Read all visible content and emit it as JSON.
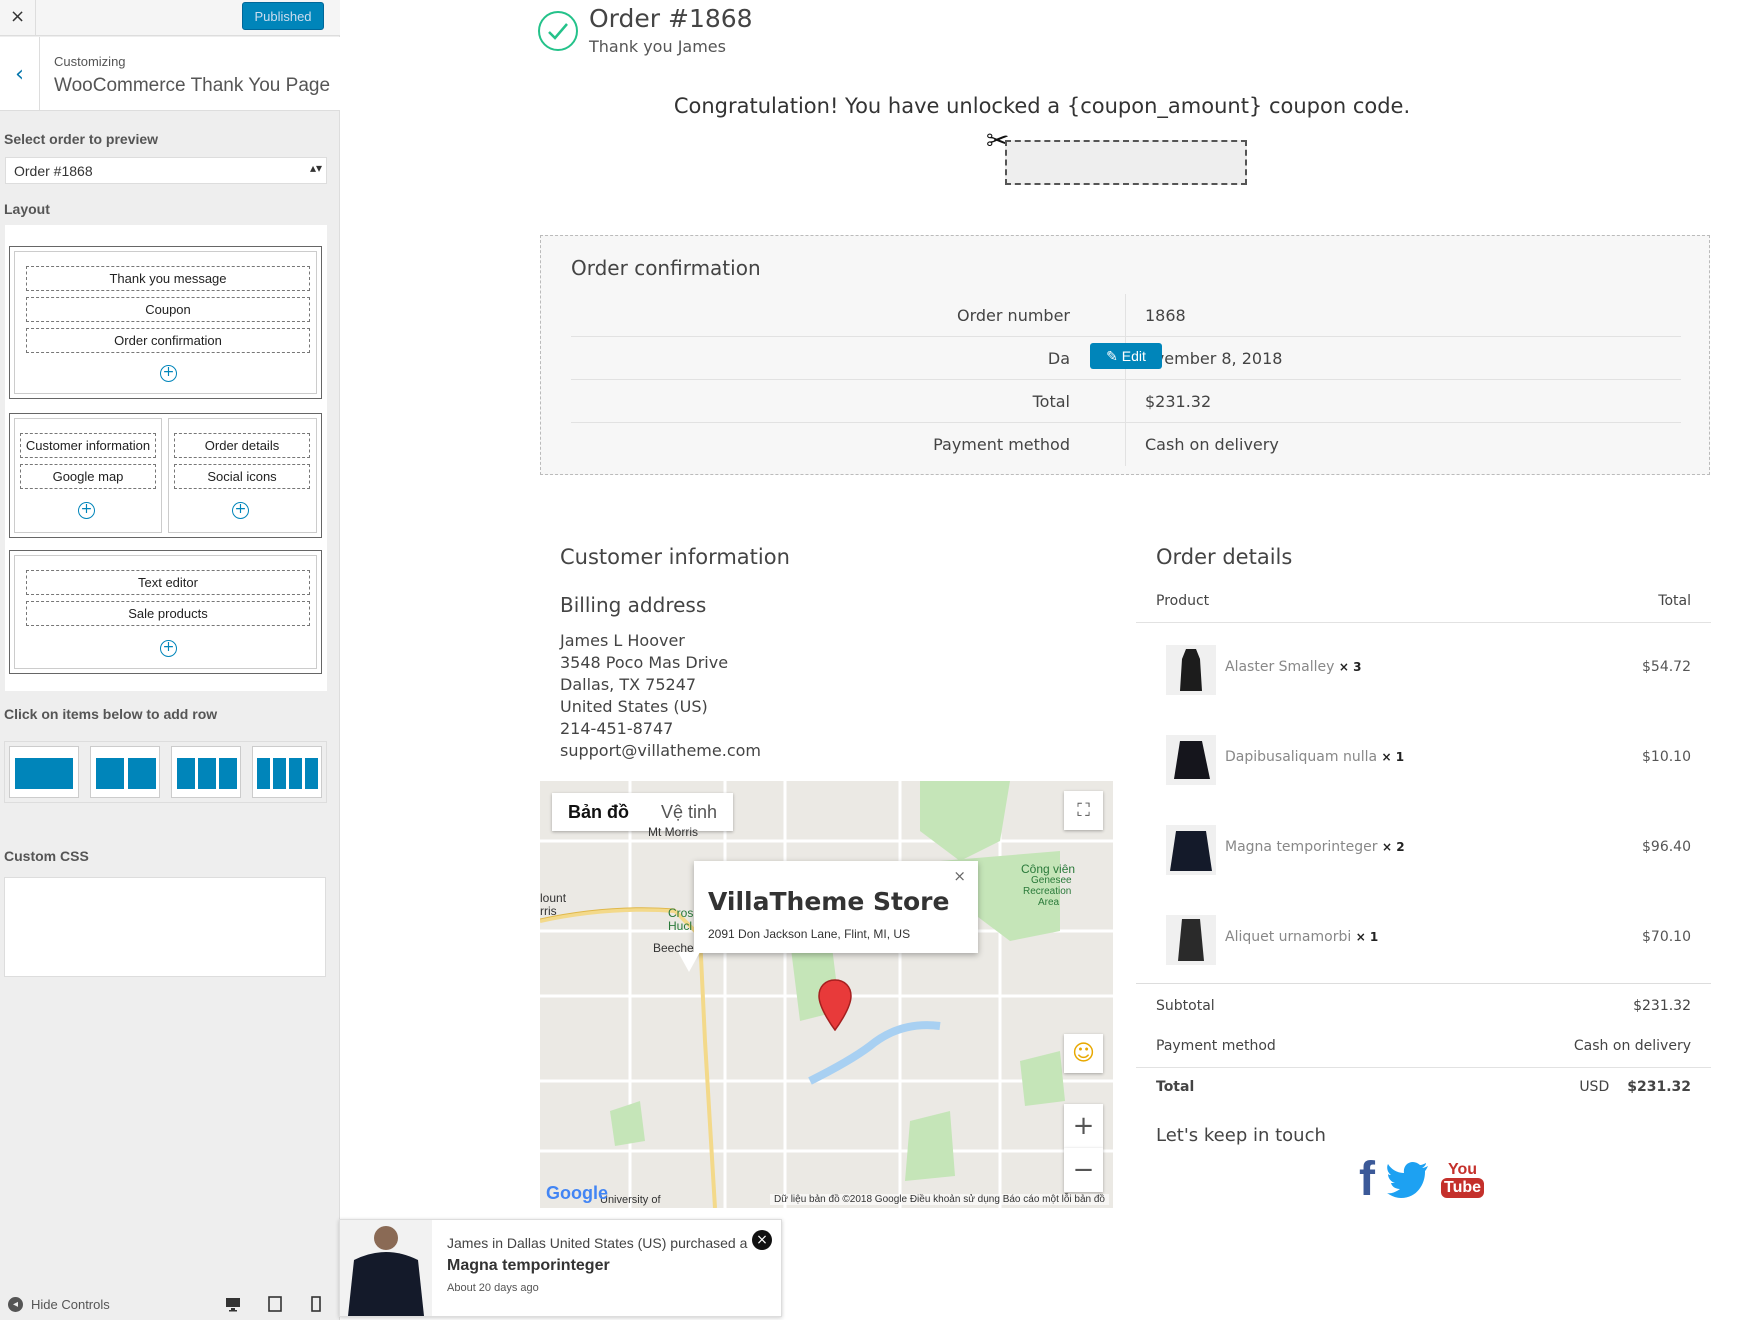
{
  "sidebar": {
    "close_icon": "×",
    "publish_label": "Published",
    "back_icon": "‹",
    "customizing_label": "Customizing",
    "page_title": "WooCommerce Thank You Page",
    "select_order_label": "Select order to preview",
    "selected_order": "Order #1868",
    "layout_label": "Layout",
    "rows": [
      {
        "items": [
          "Thank you message",
          "Coupon",
          "Order confirmation"
        ]
      },
      {
        "columns": [
          [
            "Customer information",
            "Google map"
          ],
          [
            "Order details",
            "Social icons"
          ]
        ]
      },
      {
        "items": [
          "Text editor",
          "Sale products"
        ]
      }
    ],
    "add_row_label": "Click on items below to add row",
    "custom_css_label": "Custom CSS",
    "hide_controls_label": "Hide Controls",
    "plus_icon": "+"
  },
  "main": {
    "order_title": "Order #1868",
    "thank_you": "Thank you James",
    "coupon_message": "Congratulation! You have unlocked a {coupon_amount} coupon code.",
    "order_confirmation": {
      "title": "Order confirmation",
      "rows": [
        {
          "key": "Order number",
          "value": "1868"
        },
        {
          "key": "Da",
          "value": "ovember 8, 2018"
        },
        {
          "key": "Total",
          "value": "$231.32"
        },
        {
          "key": "Payment method",
          "value": "Cash on delivery"
        }
      ],
      "edit_label": "Edit"
    },
    "customer_info": {
      "title": "Customer information",
      "billing_title": "Billing address",
      "address_lines": [
        "James L Hoover",
        "3548 Poco Mas Drive",
        "Dallas, TX 75247",
        "United States (US)",
        "214-451-8747",
        "support@villatheme.com"
      ]
    },
    "map": {
      "tab_map": "Bản đồ",
      "tab_satellite": "Vệ tinh",
      "store_name": "VillaTheme Store",
      "store_address": "2091 Don Jackson Lane, Flint, MI, US",
      "close": "×",
      "google": "Google",
      "footer": "Dữ liệu bản đồ ©2018 Google   Điều khoản sử dụng   Báo cáo một lỗi bản đồ",
      "labels": [
        "Mt Morris",
        "lount",
        "rris",
        "Cros",
        "Hucl",
        "Beeche",
        "Công viên",
        "Genesee",
        "Recreation",
        "Area",
        "University of"
      ],
      "zoom_in": "+",
      "zoom_out": "−"
    },
    "order_details": {
      "title": "Order details",
      "col_product": "Product",
      "col_total": "Total",
      "products": [
        {
          "name": "Alaster Smalley",
          "qty": "× 3",
          "price": "$54.72"
        },
        {
          "name": "Dapibusaliquam nulla",
          "qty": "× 1",
          "price": "$10.10"
        },
        {
          "name": "Magna temporinteger",
          "qty": "× 2",
          "price": "$96.40"
        },
        {
          "name": "Aliquet urnamorbi",
          "qty": "× 1",
          "price": "$70.10"
        }
      ],
      "subtotal_label": "Subtotal",
      "subtotal": "$231.32",
      "payment_label": "Payment method",
      "payment": "Cash on delivery",
      "total_label": "Total",
      "currency": "USD",
      "total": "$231.32"
    },
    "keep_in_touch": "Let's keep in touch",
    "social": {
      "facebook": "f",
      "youtube_top": "You",
      "youtube_bottom": "Tube"
    }
  },
  "toast": {
    "line1": "James in Dallas United States (US) purchased a",
    "product": "Magna temporinteger",
    "time": "About 20 days ago",
    "close": "×"
  }
}
